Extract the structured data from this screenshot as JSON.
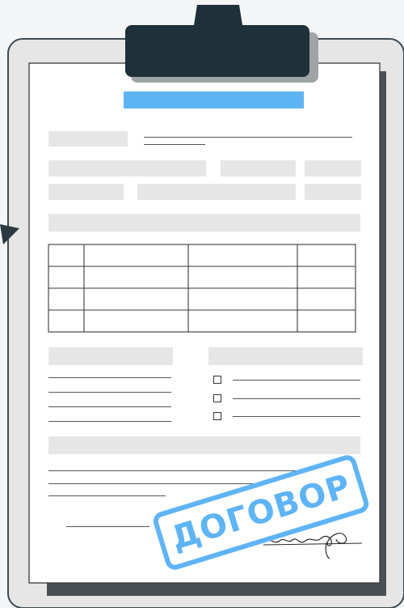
{
  "stamp": {
    "text": "ДОГОВОР"
  },
  "colors": {
    "accent": "#5fb4f5",
    "clip": "#1e3039",
    "board": "#e6e6e6",
    "paper": "#ffffff",
    "placeholder": "#e6e6e6"
  },
  "icons": [
    "clipboard-clip-icon",
    "checkbox-icon",
    "signature-icon"
  ]
}
